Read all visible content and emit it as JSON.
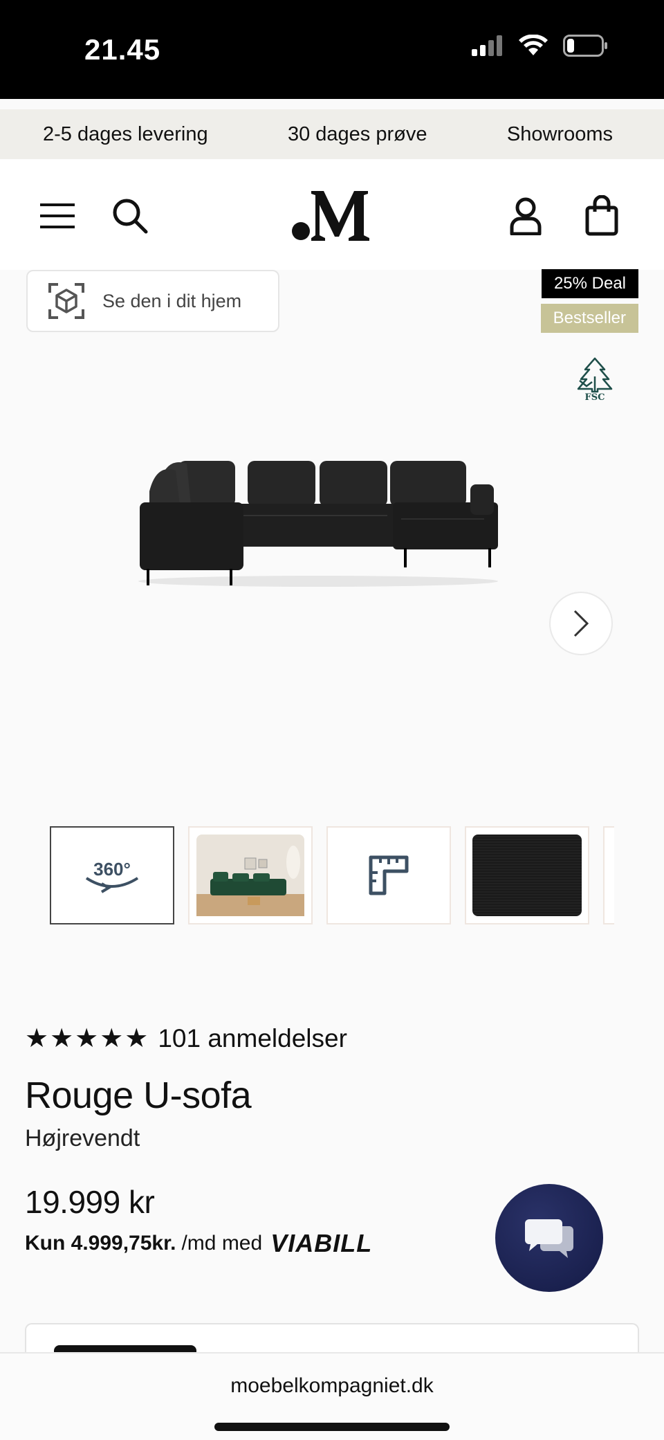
{
  "status_bar": {
    "time": "21.45",
    "icons": [
      "cellular-signal-icon",
      "wifi-icon",
      "battery-icon"
    ]
  },
  "promo_bar": {
    "items": [
      "2-5 dages levering",
      "30 dages prøve",
      "Showrooms"
    ]
  },
  "header": {
    "logo_text": ".M",
    "icons": [
      "menu-icon",
      "search-icon",
      "account-icon",
      "shopping-bag-icon"
    ]
  },
  "gallery": {
    "ar_button_label": "Se den i dit hjem",
    "badges": {
      "deal": "25% Deal",
      "bestseller": "Bestseller"
    },
    "certification": "FSC",
    "thumbnails": [
      {
        "type": "360",
        "label": "360°"
      },
      {
        "type": "room-photo"
      },
      {
        "type": "dimensions-icon"
      },
      {
        "type": "fabric-swatch"
      }
    ]
  },
  "product": {
    "stars": "★★★★★",
    "reviews": "101 anmeldelser",
    "title": "Rouge U-sofa",
    "variant": "Højrevendt",
    "price": "19.999 kr",
    "financing": {
      "amount": "Kun 4.999,75kr.",
      "suffix": "/md med",
      "provider": "VIABILL"
    }
  },
  "browser": {
    "url": "moebelkompagniet.dk"
  },
  "colors": {
    "promo_bg": "#efeeea",
    "deal_badge": "#000000",
    "bestseller_badge": "#c7c397",
    "chat_button": "#1c2353"
  }
}
